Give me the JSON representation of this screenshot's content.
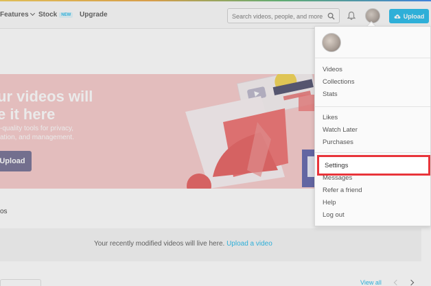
{
  "header": {
    "nav": {
      "features": "Features",
      "stock": "Stock",
      "stock_badge": "NEW",
      "upgrade": "Upgrade"
    },
    "search": {
      "placeholder": "Search videos, people, and more"
    },
    "upload": "Upload"
  },
  "banner": {
    "headline_line1": "ur videos will",
    "headline_line2": "e it here",
    "sub_line1": "-quality tools for privacy,",
    "sub_line2": "ation, and management.",
    "button": "Upload"
  },
  "videos": {
    "title": "os",
    "empty_text": "Your recently modified videos will live here.",
    "empty_link": "Upload a video",
    "view_all": "View all"
  },
  "dropdown": {
    "items_group1": [
      "Videos",
      "Collections",
      "Stats"
    ],
    "items_group2": [
      "Likes",
      "Watch Later",
      "Purchases"
    ],
    "settings": "Settings",
    "items_group3": [
      "Messages",
      "Refer a friend",
      "Help",
      "Log out"
    ]
  },
  "colors": {
    "accent": "#1ab7ea",
    "highlight": "#e8343a",
    "banner_bg": "#f7c8c8"
  }
}
